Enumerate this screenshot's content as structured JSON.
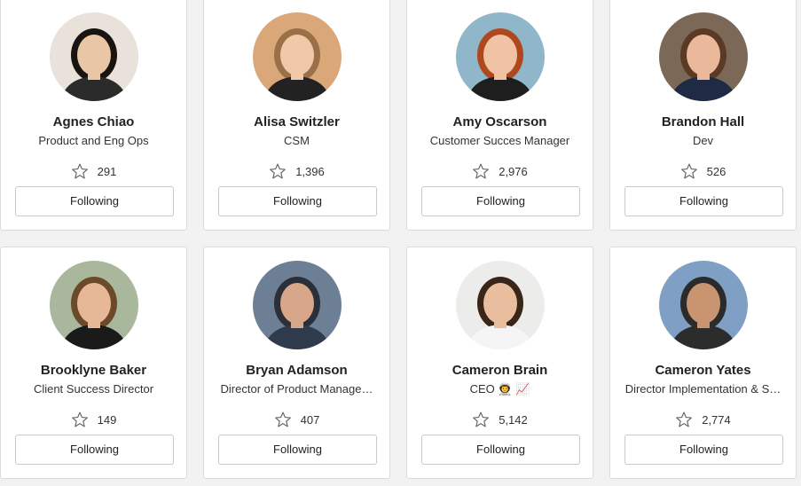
{
  "people": [
    {
      "name": "Agnes Chiao",
      "role": "Product and Eng Ops",
      "stars": "291",
      "button": "Following",
      "bg": "#e8e2da",
      "skin": "#e9c6a6",
      "hair": "#1a1410",
      "shirt": "#2b2b2b"
    },
    {
      "name": "Alisa Switzler",
      "role": "CSM",
      "stars": "1,396",
      "button": "Following",
      "bg": "#d9a778",
      "skin": "#f1c9a8",
      "hair": "#9a7048",
      "shirt": "#222222"
    },
    {
      "name": "Amy Oscarson",
      "role": "Customer Succes Manager",
      "stars": "2,976",
      "button": "Following",
      "bg": "#8fb7c9",
      "skin": "#f0c3a4",
      "hair": "#b0481f",
      "shirt": "#1e1e1e"
    },
    {
      "name": "Brandon Hall",
      "role": "Dev",
      "stars": "526",
      "button": "Following",
      "bg": "#7b6857",
      "skin": "#eab89a",
      "hair": "#5a3a24",
      "shirt": "#1f2a44"
    },
    {
      "name": "Brooklyne Baker",
      "role": "Client Success Director",
      "stars": "149",
      "button": "Following",
      "bg": "#a9b79c",
      "skin": "#e7b898",
      "hair": "#6b4a2a",
      "shirt": "#1a1a1a"
    },
    {
      "name": "Bryan Adamson",
      "role": "Director of Product Manage…",
      "stars": "407",
      "button": "Following",
      "bg": "#6d7f95",
      "skin": "#d8a688",
      "hair": "#2a2f3a",
      "shirt": "#2f3a4d"
    },
    {
      "name": "Cameron Brain",
      "role": "CEO 👨‍🚀 📈",
      "stars": "5,142",
      "button": "Following",
      "bg": "#ececea",
      "skin": "#e8be9f",
      "hair": "#3a2618",
      "shirt": "#f5f5f5"
    },
    {
      "name": "Cameron Yates",
      "role": "Director Implementation & S…",
      "stars": "2,774",
      "button": "Following",
      "bg": "#7fa0c4",
      "skin": "#c99470",
      "hair": "#2b2b2b",
      "shirt": "#2c2c2c"
    }
  ]
}
